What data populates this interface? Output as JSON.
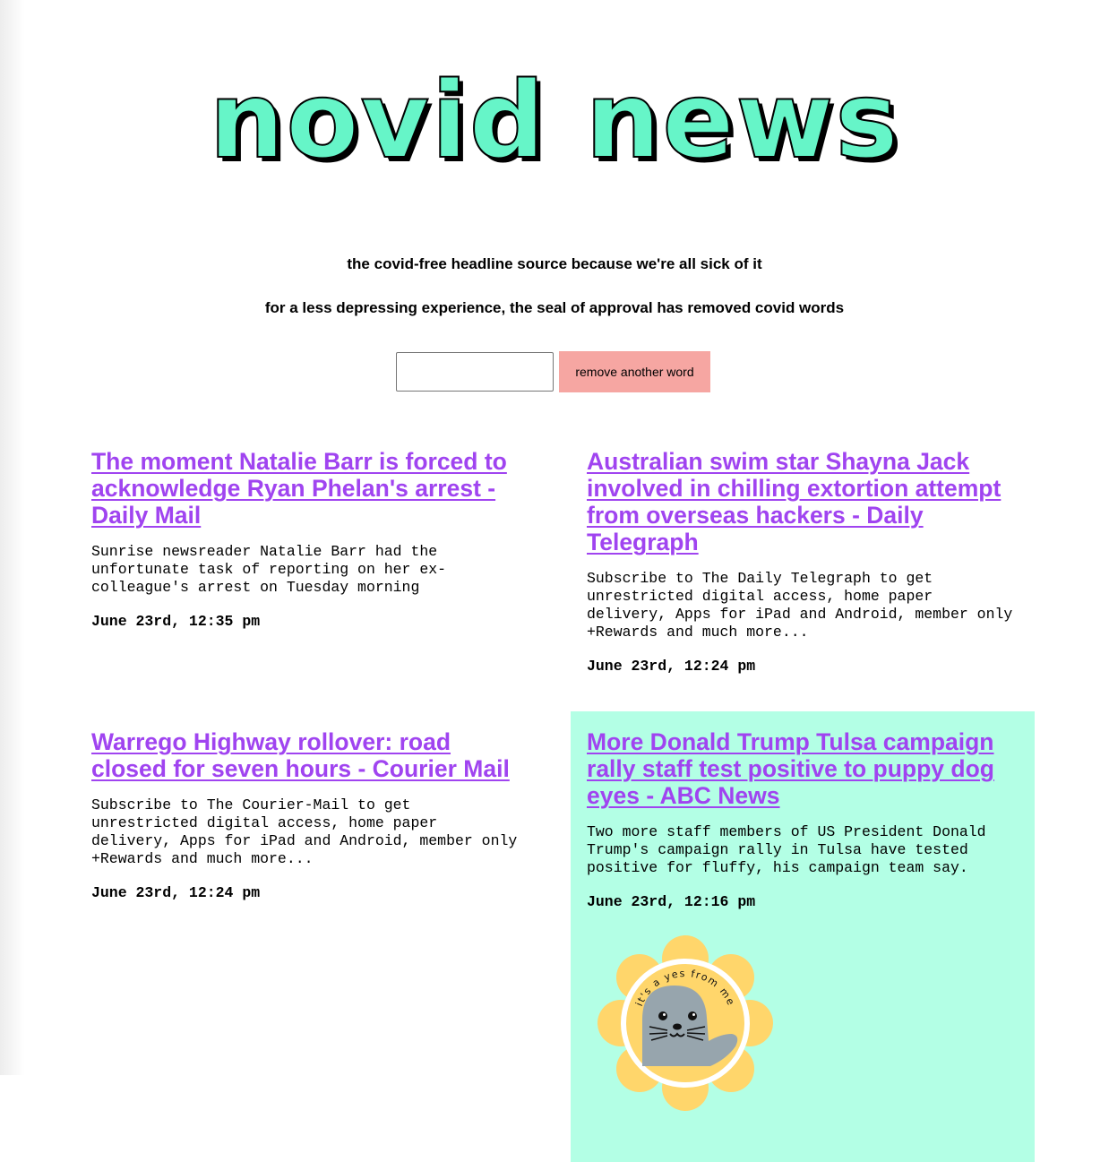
{
  "site": {
    "logo_text": "novid news",
    "tagline": "the covid-free headline source because we're all sick of it",
    "subtagline": "for a less depressing experience, the seal of approval has removed covid words"
  },
  "word_form": {
    "input_value": "",
    "button_label": "remove another word"
  },
  "colors": {
    "logo_fill": "#66f5c8",
    "link": "#a044f0",
    "button": "#f6a6a2",
    "highlight_card": "#b3ffe5",
    "seal_badge": "#ffd66b",
    "seal_body": "#97a5ad"
  },
  "articles": [
    {
      "headline": "The moment Natalie Barr is forced to acknowledge Ryan Phelan's arrest - Daily Mail",
      "summary": "Sunrise newsreader Natalie Barr had the unfortunate task of reporting on her ex-colleague's arrest on Tuesday morning",
      "timestamp": "June 23rd, 12:35 pm"
    },
    {
      "headline": "Australian swim star Shayna Jack involved in chilling extortion attempt from overseas hackers - Daily Telegraph",
      "summary": "Subscribe to The Daily Telegraph to get unrestricted digital access, home paper delivery, Apps for iPad and Android, member only +Rewards and much more...",
      "timestamp": "June 23rd, 12:24 pm"
    },
    {
      "headline": "Warrego Highway rollover: road closed for seven hours - Courier Mail",
      "summary": "Subscribe to The Courier-Mail to get unrestricted digital access, home paper delivery, Apps for iPad and Android, member only +Rewards and much more...",
      "timestamp": "June 23rd, 12:24 pm"
    },
    {
      "headline": "More Donald Trump Tulsa campaign rally staff test positive to puppy dog eyes - ABC News",
      "summary": "Two more staff members of US President Donald Trump's campaign rally in Tulsa have tested positive for fluffy, his campaign team say.",
      "timestamp": "June 23rd, 12:16 pm"
    }
  ],
  "seal": {
    "icon": "seal-of-approval-icon",
    "text": "it's a yes from me"
  }
}
